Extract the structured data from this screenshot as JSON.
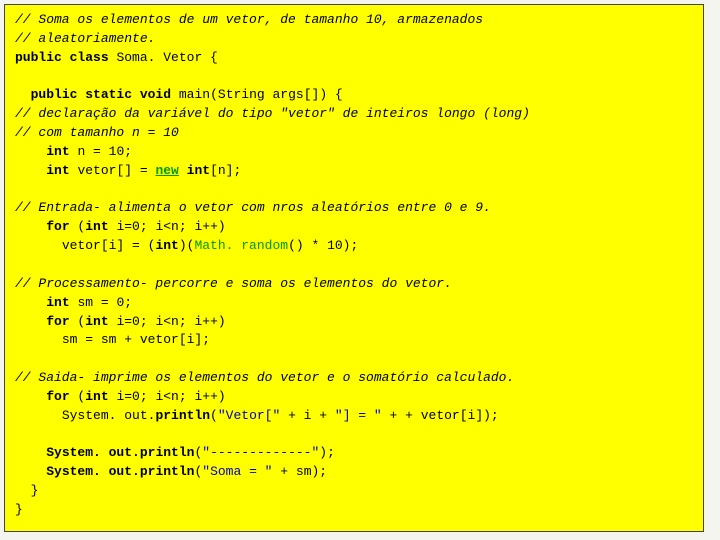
{
  "code": {
    "c1": "// Soma os elementos de um vetor, de tamanho 10, armazenados",
    "c2": "// aleatoriamente.",
    "l3_a": "public class",
    "l3_b": "Soma. Vetor {",
    "l5_a": "public static void",
    "l5_b": "main",
    "l5_c": "String args",
    "l5_d": "[]) {",
    "c6": "// declaração da variável do tipo \"vetor\" de inteiros longo (long)",
    "c7": "// com tamanho n = 10",
    "l8_a": "int",
    "l8_b": "n = 10;",
    "l9_a": "int",
    "l9_b": "vetor[] = ",
    "l9_new": "new",
    "l9_c": "int",
    "l9_d": "[n];",
    "c11": "// Entrada- alimenta o vetor com nros aleatórios entre 0 e 9.",
    "l12_a": "for",
    "l12_b": "int",
    "l12_c": "i=0; i<n; i++)",
    "l13_a": "vetor[i] = (",
    "l13_b": "int",
    "l13_c": ")(",
    "l13_d": "Math. random",
    "l13_e": "() * 10);",
    "c15": "// Processamento- percorre e soma os elementos do vetor.",
    "l16_a": "int",
    "l16_b": "sm = 0;",
    "l17_a": "for",
    "l17_b": "int",
    "l17_c": "i=0; i<n; i++)",
    "l18": "sm = sm + vetor[i];",
    "c20": "// Saida- imprime os elementos do vetor e o somatório calculado.",
    "l21_a": "for",
    "l21_b": "int",
    "l21_c": "i=0; i<n; i++)",
    "l22_a": "System. out.",
    "l22_b": "println",
    "l22_s1": "\"Vetor[\"",
    "l22_s2": "\"] = \"",
    "l22_s3": "+ vetor[i]);",
    "l22_mid": " + i + ",
    "l22_plus": " + ",
    "l24_a": "System. out.",
    "l24_b": "println",
    "l24_s": "\"-------------\"",
    "l24_end": ");",
    "l25_a": "System. out.",
    "l25_b": "println",
    "l25_s": "\"Soma = \"",
    "l25_end": " + sm);",
    "cb1": "}",
    "cb2": "}"
  }
}
